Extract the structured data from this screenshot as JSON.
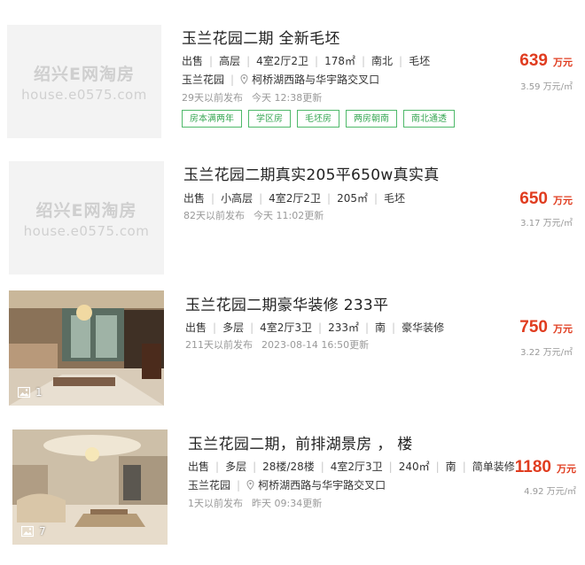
{
  "watermark": {
    "logo_text": "绍兴E网淘房",
    "url_text": "house.e0575.com"
  },
  "listings": [
    {
      "title": "玉兰花园二期 全新毛坯",
      "info": [
        "出售",
        "高层",
        "4室2厅2卫",
        "178㎡",
        "南北",
        "毛坯"
      ],
      "community": "玉兰花园",
      "address": "柯桥湖西路与华宇路交叉口",
      "posted": "29天以前发布",
      "updated": "今天 12:38更新",
      "tags": [
        "房本满两年",
        "学区房",
        "毛坯房",
        "两房朝南",
        "南北通透"
      ],
      "price": "639",
      "price_unit": "万元",
      "unit_price": "3.59 万元/㎡"
    },
    {
      "title": "玉兰花园二期真实205平650w真实真",
      "info": [
        "出售",
        "小高层",
        "4室2厅2卫",
        "205㎡",
        "毛坯"
      ],
      "posted": "82天以前发布",
      "updated": "今天 11:02更新",
      "price": "650",
      "price_unit": "万元",
      "unit_price": "3.17 万元/㎡"
    },
    {
      "title": "玉兰花园二期豪华装修 233平",
      "info": [
        "出售",
        "多层",
        "4室2厅3卫",
        "233㎡",
        "南",
        "豪华装修"
      ],
      "posted": "211天以前发布",
      "updated": "2023-08-14 16:50更新",
      "photo_count": "1",
      "price": "750",
      "price_unit": "万元",
      "unit_price": "3.22 万元/㎡"
    },
    {
      "title": "玉兰花园二期，前排湖景房 ， 楼",
      "info": [
        "出售",
        "多层",
        "28楼/28楼",
        "4室2厅3卫",
        "240㎡",
        "南",
        "简单装修"
      ],
      "community": "玉兰花园",
      "address": "柯桥湖西路与华宇路交叉口",
      "posted": "1天以前发布",
      "updated": "昨天 09:34更新",
      "photo_count": "7",
      "price": "1180",
      "price_unit": "万元",
      "unit_price": "4.92 万元/㎡"
    }
  ]
}
